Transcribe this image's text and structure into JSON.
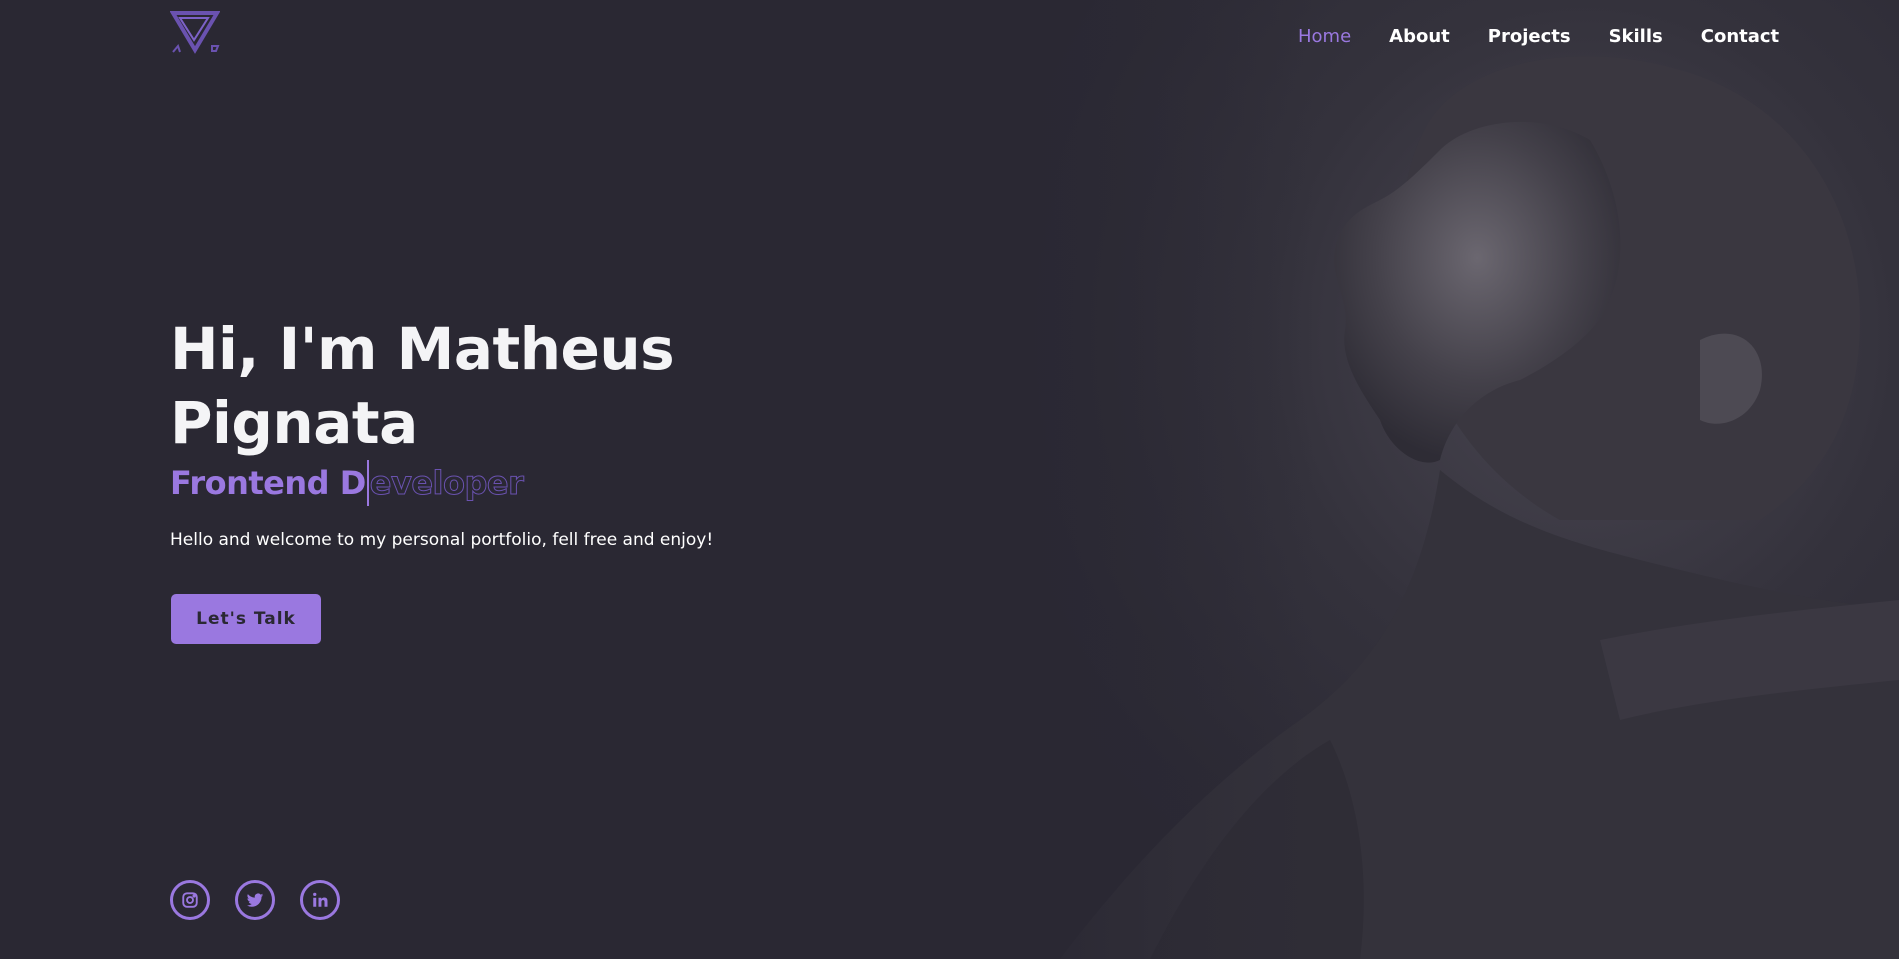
{
  "nav": {
    "items": [
      {
        "label": "Home",
        "active": true
      },
      {
        "label": "About",
        "active": false
      },
      {
        "label": "Projects",
        "active": false
      },
      {
        "label": "Skills",
        "active": false
      },
      {
        "label": "Contact",
        "active": false
      }
    ]
  },
  "hero": {
    "headline": "Hi, I'm Matheus Pignata",
    "role_typed": "Frontend D",
    "role_rest": "eveloper",
    "intro": "Hello and welcome to my personal portfolio, fell free and enjoy!",
    "cta_label": "Let's Talk"
  },
  "socials": [
    {
      "icon": "instagram-icon"
    },
    {
      "icon": "twitter-icon"
    },
    {
      "icon": "linkedin-icon"
    }
  ],
  "colors": {
    "background": "#2a2833",
    "accent": "#9a78e0",
    "text": "#ffffff"
  }
}
